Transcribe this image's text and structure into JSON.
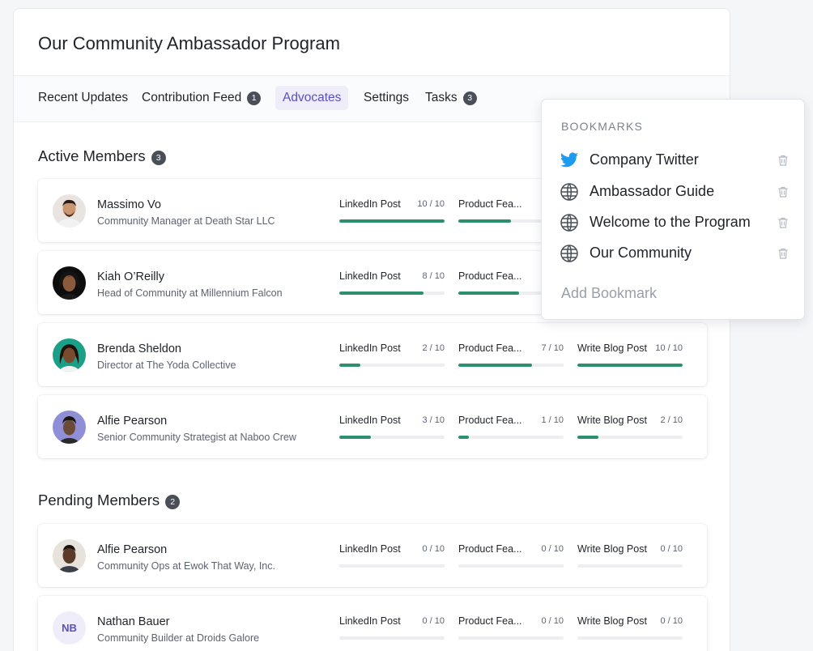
{
  "page": {
    "title": "Our Community Ambassador Program"
  },
  "tabs": [
    {
      "label": "Recent Updates",
      "badge": null
    },
    {
      "label": "Contribution Feed",
      "badge": "1"
    },
    {
      "label": "Advocates",
      "badge": null,
      "active": true
    },
    {
      "label": "Settings",
      "badge": null
    },
    {
      "label": "Tasks",
      "badge": "3"
    }
  ],
  "active_members": {
    "title": "Active Members",
    "count": "3",
    "members": [
      {
        "name": "Massimo Vo",
        "role": "Community Manager at Death Star LLC",
        "tasks": [
          {
            "label": "LinkedIn Post",
            "count": "10 / 10",
            "progress": 1.0
          },
          {
            "label": "Product Fea...",
            "count": "",
            "progress": 0.5
          }
        ]
      },
      {
        "name": "Kiah O’Reilly",
        "role": "Head of Community at Millennium Falcon",
        "tasks": [
          {
            "label": "LinkedIn Post",
            "count": "8 / 10",
            "progress": 0.8
          },
          {
            "label": "Product Fea...",
            "count": "",
            "progress": 0.58
          }
        ]
      },
      {
        "name": "Brenda Sheldon",
        "role": "Director at The Yoda Collective",
        "tasks": [
          {
            "label": "LinkedIn Post",
            "count": "2 / 10",
            "progress": 0.2
          },
          {
            "label": "Product Fea...",
            "count": "7 / 10",
            "progress": 0.7
          },
          {
            "label": "Write Blog Post",
            "count": "10 / 10",
            "progress": 1.0
          }
        ]
      },
      {
        "name": "Alfie Pearson",
        "role": "Senior Community Strategist at Naboo Crew",
        "tasks": [
          {
            "label": "LinkedIn Post",
            "count": "3 / 10",
            "progress": 0.3
          },
          {
            "label": "Product Fea...",
            "count": "1 / 10",
            "progress": 0.1
          },
          {
            "label": "Write Blog Post",
            "count": "2 / 10",
            "progress": 0.2
          }
        ]
      }
    ]
  },
  "pending_members": {
    "title": "Pending Members",
    "count": "2",
    "members": [
      {
        "name": "Alfie Pearson",
        "role": "Community Ops at Ewok That Way, Inc.",
        "tasks": [
          {
            "label": "LinkedIn Post",
            "count": "0 / 10",
            "progress": 0
          },
          {
            "label": "Product Fea...",
            "count": "0 / 10",
            "progress": 0
          },
          {
            "label": "Write Blog Post",
            "count": "0 / 10",
            "progress": 0
          }
        ]
      },
      {
        "name": "Nathan Bauer",
        "role": "Community Builder at Droids Galore",
        "initials": "NB",
        "tasks": [
          {
            "label": "LinkedIn Post",
            "count": "0 / 10",
            "progress": 0
          },
          {
            "label": "Product Fea...",
            "count": "0 / 10",
            "progress": 0
          },
          {
            "label": "Write Blog Post",
            "count": "0 / 10",
            "progress": 0
          }
        ]
      }
    ]
  },
  "bookmarks": {
    "heading": "BOOKMARKS",
    "items": [
      {
        "label": "Company Twitter",
        "icon": "twitter-icon"
      },
      {
        "label": "Ambassador Guide",
        "icon": "globe-icon"
      },
      {
        "label": "Welcome to the Program",
        "icon": "globe-icon"
      },
      {
        "label": "Our Community",
        "icon": "globe-icon"
      }
    ],
    "add_label": "Add Bookmark"
  },
  "colors": {
    "accent": "#5b4fc4",
    "progress": "#2e8f6c",
    "twitter": "#1d9bf0"
  }
}
